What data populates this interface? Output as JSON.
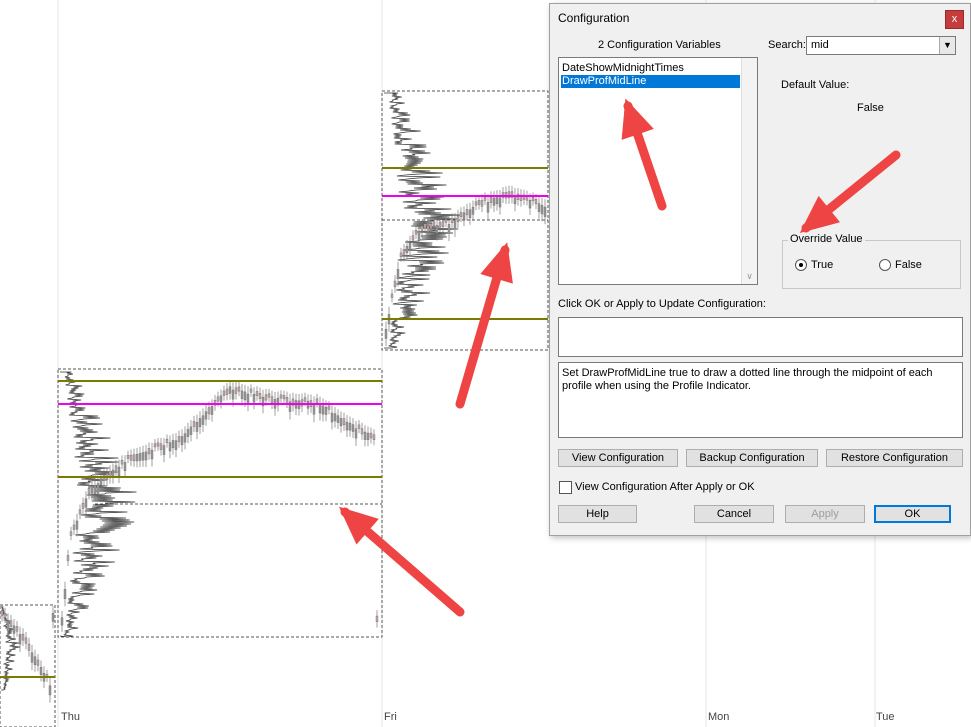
{
  "chart": {
    "x_labels": [
      "Thu",
      "Fri",
      "Mon",
      "Tue"
    ],
    "colors": {
      "level_line": "#7b7b00",
      "mid_line": "#ee00ee",
      "box": "#555555",
      "grid": "#e6e6e6",
      "candle_up": "#999999",
      "candle_down": "#c8a8a8",
      "annotation_arrow": "#ef4444"
    }
  },
  "dialog": {
    "title": "Configuration",
    "close_glyph": "x",
    "variable_count_label": "2 Configuration Variables",
    "search": {
      "label": "Search:",
      "value": "mid",
      "dropdown_icon": "chevron-down-icon"
    },
    "variables": [
      {
        "label": "DateShowMidnightTimes",
        "selected": false
      },
      {
        "label": "DrawProfMidLine",
        "selected": true
      }
    ],
    "default_value_label": "Default Value:",
    "default_value": "False",
    "override": {
      "label": "Override Value",
      "options": [
        {
          "label": "True",
          "checked": true
        },
        {
          "label": "False",
          "checked": false
        }
      ]
    },
    "update_label": "Click OK or Apply to Update Configuration:",
    "update_text": "",
    "description": "Set DrawProfMidLine true to draw a dotted line through the midpoint of each profile when using the Profile Indicator.",
    "buttons": {
      "view_config": "View Configuration",
      "backup_config": "Backup Configuration",
      "restore_config": "Restore Configuration",
      "help": "Help",
      "cancel": "Cancel",
      "apply": "Apply",
      "ok": "OK"
    },
    "view_after_apply": {
      "label": "View Configuration After Apply or OK",
      "checked": false
    }
  }
}
